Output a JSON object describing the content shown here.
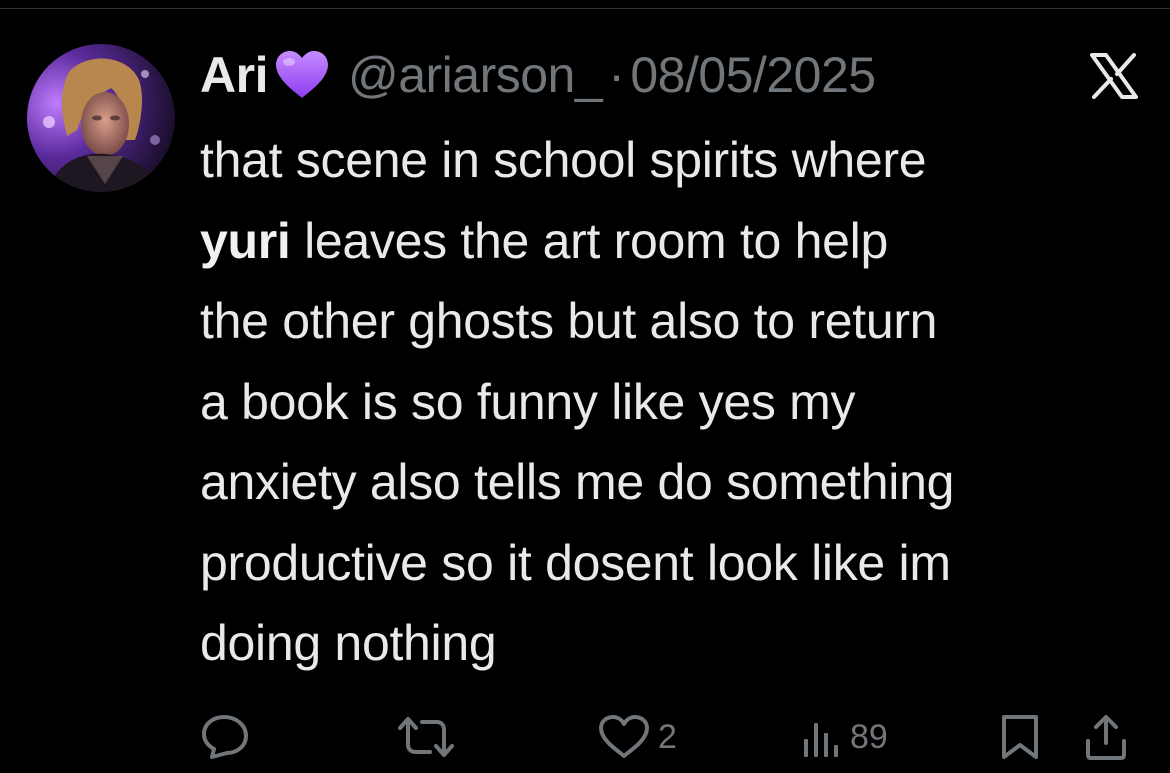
{
  "tweet": {
    "display_name": "Ari",
    "verified_emoji": "purple-heart",
    "handle": "@ariarson_",
    "separator": "·",
    "date": "08/05/2025",
    "text_lines": [
      {
        "pre": "that scene in school spirits where",
        "bold": "",
        "post": ""
      },
      {
        "pre": "",
        "bold": "yuri",
        "post": " leaves the art room to help"
      },
      {
        "pre": "the other ghosts but also to return",
        "bold": "",
        "post": ""
      },
      {
        "pre": "a book is so funny like yes my",
        "bold": "",
        "post": ""
      },
      {
        "pre": "anxiety also tells me do something",
        "bold": "",
        "post": ""
      },
      {
        "pre": "productive so it dosent look like im",
        "bold": "",
        "post": ""
      },
      {
        "pre": "doing nothing",
        "bold": "",
        "post": ""
      }
    ]
  },
  "actions": {
    "reply": {
      "icon": "reply-icon",
      "count": ""
    },
    "retweet": {
      "icon": "retweet-icon",
      "count": ""
    },
    "like": {
      "icon": "heart-outline-icon",
      "count": "2"
    },
    "views": {
      "icon": "views-icon",
      "count": "89"
    },
    "bookmark": {
      "icon": "bookmark-icon",
      "count": ""
    },
    "share": {
      "icon": "share-icon",
      "count": ""
    }
  },
  "colors": {
    "background": "#000000",
    "text_primary": "#e7e9ea",
    "text_secondary": "#71767b",
    "heart": "#a25cff"
  }
}
